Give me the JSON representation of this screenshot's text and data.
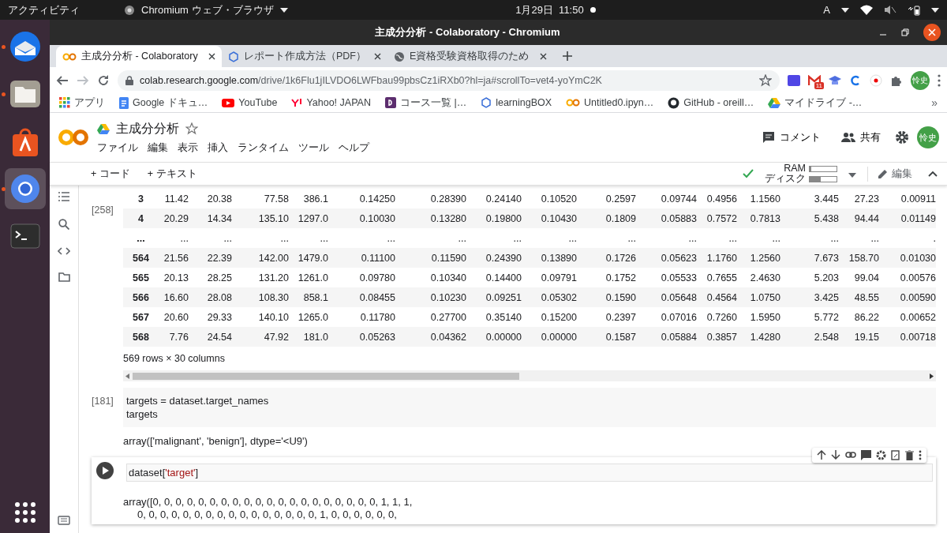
{
  "topbar": {
    "activities": "アクティビティ",
    "app_menu": "Chromium ウェブ・ブラウザ",
    "clock": "1月29日  11:50",
    "input_method": "A"
  },
  "dock": [
    {
      "kind": "thunderbird",
      "running": true,
      "selected": false
    },
    {
      "kind": "files",
      "running": true,
      "selected": false
    },
    {
      "kind": "software",
      "running": false,
      "selected": false
    },
    {
      "kind": "chromium",
      "running": true,
      "selected": true
    },
    {
      "kind": "terminal",
      "running": false,
      "selected": false
    }
  ],
  "window": {
    "title": "主成分分析 - Colaboratory - Chromium"
  },
  "tabs": [
    {
      "kind": "colab",
      "title": "主成分分析 - Colaboratory",
      "selected": true
    },
    {
      "kind": "learningbox",
      "title": "レポート作成方法（PDF）",
      "selected": false
    },
    {
      "kind": "globe",
      "title": "E資格受験資格取得のため",
      "selected": false
    }
  ],
  "address": {
    "host": "colab.research.google.com",
    "path": "/drive/1k6Flu1jILVDO6LWFbau99pbsCz1iRXb0?hl=ja#scrollTo=vet4-yoYmC2K"
  },
  "extensions": {
    "mail_badge": "11",
    "avatar": "怜史"
  },
  "bookmarks": [
    {
      "kind": "apps",
      "label": "アプリ"
    },
    {
      "kind": "docs",
      "label": "Google ドキュ…"
    },
    {
      "kind": "youtube",
      "label": "YouTube"
    },
    {
      "kind": "yahoo",
      "label": "Yahoo! JAPAN"
    },
    {
      "kind": "course",
      "label": "コース一覧 |…"
    },
    {
      "kind": "learningbox",
      "label": "learningBOX"
    },
    {
      "kind": "colab",
      "label": "Untitled0.ipyn…"
    },
    {
      "kind": "github",
      "label": "GitHub - oreill…"
    },
    {
      "kind": "drive",
      "label": "マイドライブ -…"
    }
  ],
  "bookmarks_more": "»",
  "notebook": {
    "title": "主成分分析",
    "menu": [
      "ファイル",
      "編集",
      "表示",
      "挿入",
      "ランタイム",
      "ツール",
      "ヘルプ"
    ],
    "comment": "コメント",
    "share": "共有",
    "avatar": "怜史",
    "add_code": "+ コード",
    "add_text": "+ テキスト",
    "ram": {
      "label": "RAM",
      "level": 0.05
    },
    "disk": {
      "label": "ディスク",
      "level": 0.4
    },
    "edit": "編集"
  },
  "table_cell": {
    "exec": "[258]",
    "rows": [
      {
        "index": "3",
        "cells": [
          "11.42",
          "20.38",
          "77.58",
          "386.1",
          "0.14250",
          "0.28390",
          "0.24140",
          "0.10520",
          "0.2597",
          "0.09744",
          "0.4956",
          "1.1560",
          "3.445",
          "27.23",
          "0.00911"
        ]
      },
      {
        "index": "4",
        "cells": [
          "20.29",
          "14.34",
          "135.10",
          "1297.0",
          "0.10030",
          "0.13280",
          "0.19800",
          "0.10430",
          "0.1809",
          "0.05883",
          "0.7572",
          "0.7813",
          "5.438",
          "94.44",
          "0.01149"
        ]
      },
      {
        "index": "...",
        "cells": [
          "...",
          "...",
          "...",
          "...",
          "...",
          "...",
          "...",
          "...",
          "...",
          "...",
          "...",
          "...",
          "...",
          "...",
          "."
        ]
      },
      {
        "index": "564",
        "cells": [
          "21.56",
          "22.39",
          "142.00",
          "1479.0",
          "0.11100",
          "0.11590",
          "0.24390",
          "0.13890",
          "0.1726",
          "0.05623",
          "1.1760",
          "1.2560",
          "7.673",
          "158.70",
          "0.01030"
        ]
      },
      {
        "index": "565",
        "cells": [
          "20.13",
          "28.25",
          "131.20",
          "1261.0",
          "0.09780",
          "0.10340",
          "0.14400",
          "0.09791",
          "0.1752",
          "0.05533",
          "0.7655",
          "2.4630",
          "5.203",
          "99.04",
          "0.00576"
        ]
      },
      {
        "index": "566",
        "cells": [
          "16.60",
          "28.08",
          "108.30",
          "858.1",
          "0.08455",
          "0.10230",
          "0.09251",
          "0.05302",
          "0.1590",
          "0.05648",
          "0.4564",
          "1.0750",
          "3.425",
          "48.55",
          "0.00590"
        ]
      },
      {
        "index": "567",
        "cells": [
          "20.60",
          "29.33",
          "140.10",
          "1265.0",
          "0.11780",
          "0.27700",
          "0.35140",
          "0.15200",
          "0.2397",
          "0.07016",
          "0.7260",
          "1.5950",
          "5.772",
          "86.22",
          "0.00652"
        ]
      },
      {
        "index": "568",
        "cells": [
          "7.76",
          "24.54",
          "47.92",
          "181.0",
          "0.05263",
          "0.04362",
          "0.00000",
          "0.00000",
          "0.1587",
          "0.05884",
          "0.3857",
          "1.4280",
          "2.548",
          "19.15",
          "0.00718"
        ]
      }
    ],
    "footer": "569 rows × 30 columns"
  },
  "code_cells": [
    {
      "exec": "[181]",
      "focused": false,
      "lines": [
        [
          {
            "kind": "plain",
            "text": "targets = dataset.target_names"
          }
        ],
        [
          {
            "kind": "plain",
            "text": "targets"
          }
        ]
      ],
      "output": [
        "array(['malignant', 'benign'], dtype='<U9')"
      ]
    },
    {
      "focused": true,
      "lines": [
        [
          {
            "kind": "plain",
            "text": "dataset["
          },
          {
            "kind": "string",
            "text": "'target'"
          },
          {
            "kind": "plain",
            "text": "]"
          }
        ]
      ],
      "output": [
        "array([0, 0, 0, 0, 0, 0, 0, 0, 0, 0, 0, 0, 0, 0, 0, 0, 0, 0, 0, 0, 1, 1, 1,",
        "0, 0, 0, 0, 0, 0, 0, 0, 0, 0, 0, 0, 0, 0, 0, 0, 1, 0, 0, 0, 0, 0, 0,"
      ]
    }
  ]
}
